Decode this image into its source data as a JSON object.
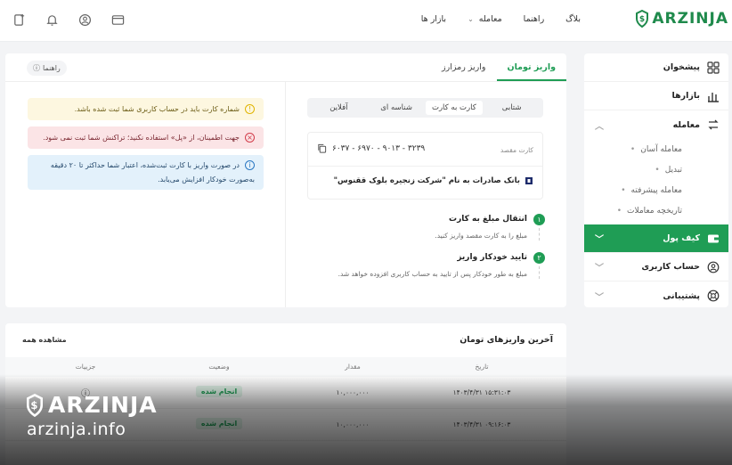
{
  "brand": {
    "name": "ARZINJA",
    "color": "#1f9d55"
  },
  "nav": {
    "markets": "بازار ها",
    "trade": "معامله",
    "guide": "راهنما",
    "blog": "بلاگ"
  },
  "top_icons": [
    "wallet-icon",
    "user-icon",
    "bell-icon",
    "add-device-icon"
  ],
  "sidebar": {
    "items": [
      {
        "label": "پیشخوان",
        "icon": "grid-icon"
      },
      {
        "label": "بازارها",
        "icon": "bar-chart-icon"
      },
      {
        "label": "معامله",
        "icon": "trade-icon"
      },
      {
        "label": "کیف پول",
        "icon": "wallet-icon"
      },
      {
        "label": "حساب کاربری",
        "icon": "user-icon"
      },
      {
        "label": "پشتیبانی",
        "icon": "support-icon"
      }
    ],
    "sub_items": [
      "معامله آسان",
      "تبدیل",
      "معامله پیشرفته",
      "تاریخچه معاملات"
    ]
  },
  "main": {
    "tabs": [
      "واریز تومان",
      "واریز رمزارز"
    ],
    "guide_label": "راهنما",
    "alerts": {
      "warning": "شماره کارت باید در حساب کاربری شما ثبت شده باشد.",
      "error": "جهت اطمینان، از «پل» استفاده نکنید؛ تراکنش شما ثبت نمی شود.",
      "info": "در صورت واریز با کارت ثبت‌شده، اعتبار شما حداکثر تا ۲۰ دقیقه به‌صورت خودکار افزایش می‌یابد."
    },
    "methods": [
      "شتابی",
      "کارت به کارت",
      "شناسه ای",
      "آفلاین"
    ],
    "card": {
      "label": "کارت مقصد",
      "number": "۶۰۳۷ - ۶۹۷۰ - ۹۰۱۳ - ۳۲۳۹",
      "bank": "بانک صادرات به نام \"شرکت زنجیره بلوک ققنوس\""
    },
    "steps": [
      {
        "num": "۱",
        "title": "انتقال مبلغ به کارت",
        "desc": "مبلغ را به کارت مقصد واریز کنید."
      },
      {
        "num": "۲",
        "title": "تایید خودکار واریز",
        "desc": "مبلغ به طور خودکار پس از تایید به حساب کاربری افزوده خواهد شد."
      }
    ]
  },
  "history": {
    "title": "آخرین واریزهای تومان",
    "view_all": "مشاهده همه",
    "columns": [
      "تاریخ",
      "مقدار",
      "وضعیت",
      "جزییات"
    ],
    "rows": [
      {
        "date": "۱۴۰۳/۴/۳۱ ۱۵:۳۱:۰۳",
        "amount": "۱۰,۰۰۰,۰۰۰",
        "status": "انجام شده"
      },
      {
        "date": "۱۴۰۳/۴/۳۱ ۰۹:۱۶:۰۳",
        "amount": "۱۰,۰۰۰,۰۰۰",
        "status": "انجام شده"
      }
    ]
  },
  "watermark": {
    "brand": "ARZINJA",
    "site": "arzinja.info"
  }
}
